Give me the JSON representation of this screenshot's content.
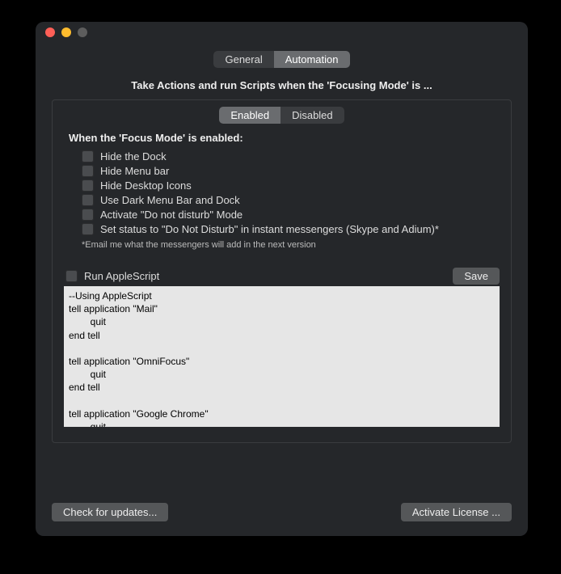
{
  "tabs": {
    "general": "General",
    "automation": "Automation"
  },
  "subtitle": "Take Actions and run Scripts when the 'Focusing Mode' is ...",
  "state_tabs": {
    "enabled": "Enabled",
    "disabled": "Disabled"
  },
  "section_title": "When the 'Focus Mode' is enabled:",
  "checks": [
    "Hide the Dock",
    "Hide Menu bar",
    "Hide Desktop Icons",
    "Use Dark Menu Bar and Dock",
    "Activate \"Do not disturb\" Mode",
    "Set status to \"Do Not Disturb\" in instant messengers (Skype and Adium)*"
  ],
  "note": "*Email me what the messengers will add in the next version",
  "run_script_label": "Run AppleScript",
  "save_label": "Save",
  "script_text": "--Using AppleScript\ntell application \"Mail\"\n        quit\nend tell\n\ntell application \"OmniFocus\"\n        quit\nend tell\n\ntell application \"Google Chrome\"\n        quit\nend tell",
  "footer": {
    "check_updates": "Check for updates...",
    "activate": "Activate License ..."
  }
}
